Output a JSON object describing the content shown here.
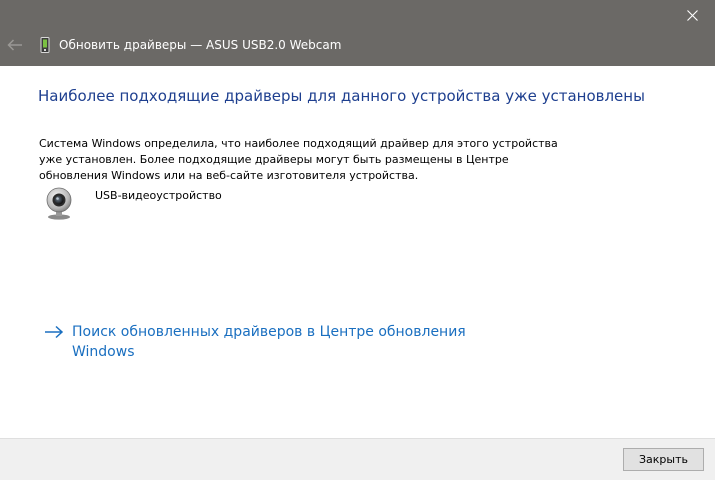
{
  "window": {
    "title": "Обновить драйверы — ASUS USB2.0 Webcam",
    "titlebar_color": "#6b6966"
  },
  "icons": {
    "back": "back-arrow-icon",
    "close": "close-icon",
    "device_small": "device-icon",
    "webcam": "webcam-icon",
    "link_arrow": "arrow-right-icon"
  },
  "main": {
    "heading": "Наиболее подходящие драйверы для данного устройства уже установлены",
    "description": "Система Windows определила, что наиболее подходящий драйвер для этого устройства уже установлен. Более подходящие драйверы могут быть размещены в Центре обновления Windows или на веб-сайте изготовителя устройства.",
    "device_name": "USB-видеоустройство",
    "update_link": "Поиск обновленных драйверов в Центре обновления Windows",
    "heading_color": "#1e3f8f",
    "link_color": "#1a6fc0"
  },
  "footer": {
    "close_label": "Закрыть"
  }
}
